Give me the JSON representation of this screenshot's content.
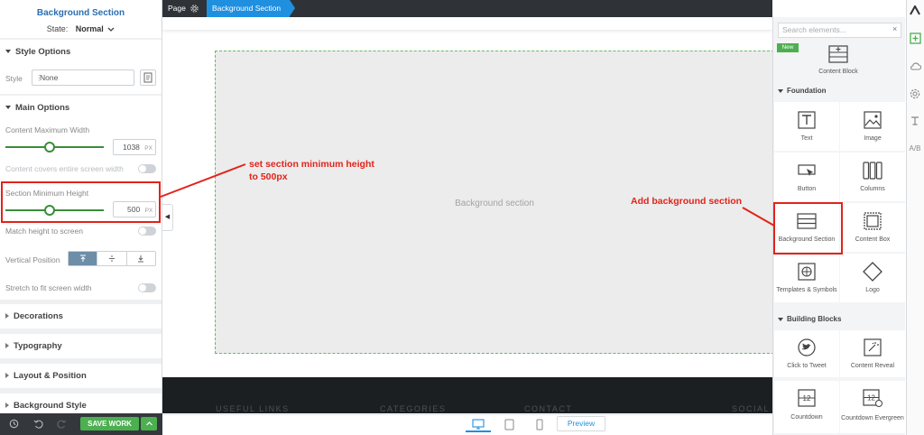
{
  "left_panel": {
    "title": "Background Section",
    "state_label": "State:",
    "state_value": "Normal",
    "style_options": {
      "header": "Style Options",
      "style_label": "Style",
      "style_value": "None"
    },
    "main_options": {
      "header": "Main Options",
      "content_max_width_label": "Content Maximum Width",
      "content_max_width_value": "1038",
      "content_max_width_unit": "PX",
      "content_max_width_fraction": 0.45,
      "covers_screen_label": "Content covers entire screen width",
      "section_min_height_label": "Section Minimum Height",
      "section_min_height_value": "500",
      "section_min_height_unit": "PX",
      "section_min_height_fraction": 0.45,
      "match_height_label": "Match height to screen",
      "vertical_position_label": "Vertical Position",
      "vertical_position_options": [
        "top",
        "center",
        "bottom"
      ],
      "vertical_position_selected": "top",
      "stretch_label": "Stretch to fit screen width"
    },
    "collapsed_sections": [
      "Decorations",
      "Typography",
      "Layout & Position",
      "Background Style"
    ],
    "save_label": "SAVE WORK"
  },
  "breadcrumb": {
    "page": "Page",
    "current": "Background Section"
  },
  "canvas": {
    "section_label": "Background section",
    "footer_headings": [
      "USEFUL LINKS",
      "CATEGORIES",
      "CONTACT",
      "SOCIAL"
    ]
  },
  "device_bar": {
    "devices": [
      "desktop",
      "tablet",
      "mobile"
    ],
    "preview_label": "Preview"
  },
  "right_panel": {
    "search_placeholder": "Search elements...",
    "new_badge": "New",
    "featured_tile": "Content Block",
    "foundation_header": "Foundation",
    "foundation_items": [
      "Text",
      "Image",
      "Button",
      "Columns",
      "Background Section",
      "Content Box",
      "Templates & Symbols",
      "Logo"
    ],
    "building_blocks_header": "Building Blocks",
    "building_blocks_items": [
      "Click to Tweet",
      "Content Reveal",
      "Countdown",
      "Countdown Evergreen"
    ]
  },
  "annotations": {
    "left_note": "set section minimum height to 500px",
    "right_note": "Add background section"
  },
  "colors": {
    "accent_blue": "#1f8fe0",
    "save_green": "#4caf50",
    "annotation_red": "#e2231a",
    "slider_green": "#3a8d3a"
  }
}
